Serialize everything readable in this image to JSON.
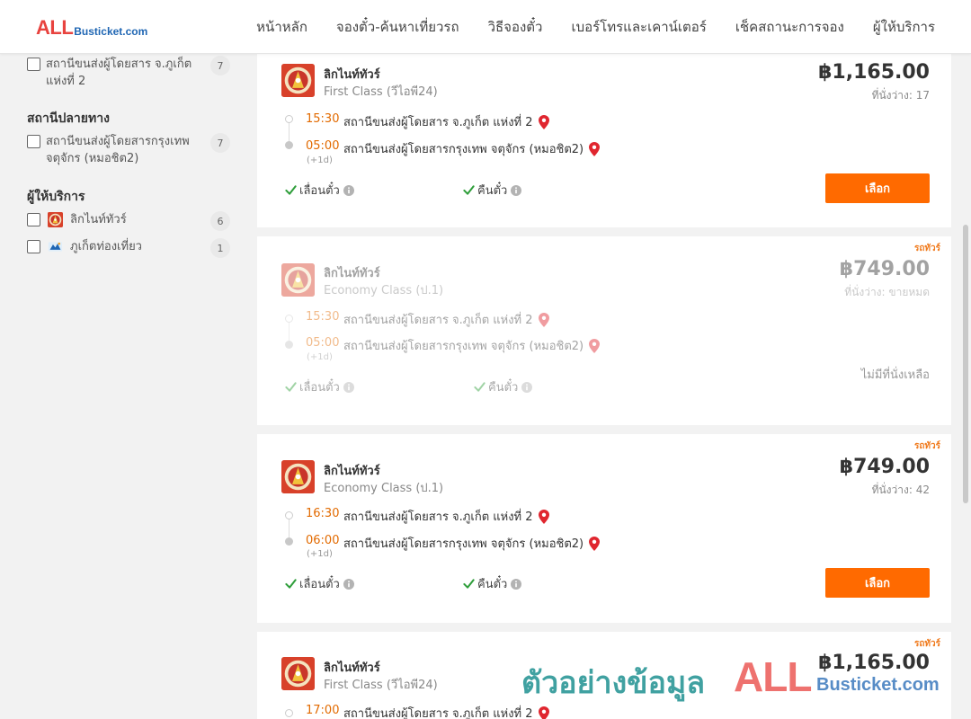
{
  "header": {
    "logo_main": "ALL",
    "logo_rest": "Busticket.com",
    "nav": [
      "หน้าหลัก",
      "จองตั๋ว-ค้นหาเที่ยวรถ",
      "วิธีจองตั๋ว",
      "เบอร์โทรและเคาน์เตอร์",
      "เช็คสถานะการจอง",
      "ผู้ให้บริการ"
    ]
  },
  "sidebar": {
    "origin_item": {
      "label": "สถานีขนส่งผู้โดยสาร จ.ภูเก็ต แห่งที่ 2",
      "count": "7"
    },
    "destination_heading": "สถานีปลายทาง",
    "destination_item": {
      "label": "สถานีขนส่งผู้โดยสารกรุงเทพ จตุจักร (หมอชิต2)",
      "count": "7"
    },
    "operator_heading": "ผู้ให้บริการ",
    "operators": [
      {
        "label": "ลิกไนท์ทัวร์",
        "count": "6",
        "icon": "ligna-tour-logo"
      },
      {
        "label": "ภูเก็ตท่องเที่ยว",
        "count": "1",
        "icon": "phuket-travel-logo"
      }
    ]
  },
  "common": {
    "plus_day": "(+1d)",
    "change_ticket": "เลื่อนตั๋ว",
    "refund_ticket": "คืนตั๋ว",
    "select_button": "เลือก",
    "badge": "รถทัวร์",
    "no_seat": "ไม่มีที่นั่งเหลือ"
  },
  "trips": [
    {
      "operator": "ลิกไนท์ทัวร์",
      "class": "First Class (วีไอพี24)",
      "price": "฿1,165.00",
      "seats": "ที่นั่งว่าง: 17",
      "depart_time": "15:30",
      "depart_stop": "สถานีขนส่งผู้โดยสาร จ.ภูเก็ต แห่งที่ 2",
      "arrive_time": "05:00",
      "arrive_stop": "สถานีขนส่งผู้โดยสารกรุงเทพ จตุจักร (หมอชิต2)",
      "available": true
    },
    {
      "operator": "ลิกไนท์ทัวร์",
      "class": "Economy Class (ป.1)",
      "price": "฿749.00",
      "seats": "ที่นั่งว่าง: ขายหมด",
      "depart_time": "15:30",
      "depart_stop": "สถานีขนส่งผู้โดยสาร จ.ภูเก็ต แห่งที่ 2",
      "arrive_time": "05:00",
      "arrive_stop": "สถานีขนส่งผู้โดยสารกรุงเทพ จตุจักร (หมอชิต2)",
      "available": false
    },
    {
      "operator": "ลิกไนท์ทัวร์",
      "class": "Economy Class (ป.1)",
      "price": "฿749.00",
      "seats": "ที่นั่งว่าง: 42",
      "depart_time": "16:30",
      "depart_stop": "สถานีขนส่งผู้โดยสาร จ.ภูเก็ต แห่งที่ 2",
      "arrive_time": "06:00",
      "arrive_stop": "สถานีขนส่งผู้โดยสารกรุงเทพ จตุจักร (หมอชิต2)",
      "available": true
    },
    {
      "operator": "ลิกไนท์ทัวร์",
      "class": "First Class (วีไอพี24)",
      "price": "฿1,165.00",
      "depart_time": "17:00",
      "depart_stop": "สถานีขนส่งผู้โดยสาร จ.ภูเก็ต แห่งที่ 2"
    }
  ],
  "watermark": {
    "text": "ตัวอย่างข้อมูล",
    "logo_main": "ALL",
    "logo_rest": "Busticket.com"
  },
  "colors": {
    "accent": "#ff6a00",
    "time": "#e26a00",
    "pin": "#e0262f",
    "check": "#2e9e3a",
    "brand_red": "#e8433f",
    "brand_blue": "#1f66b3"
  }
}
